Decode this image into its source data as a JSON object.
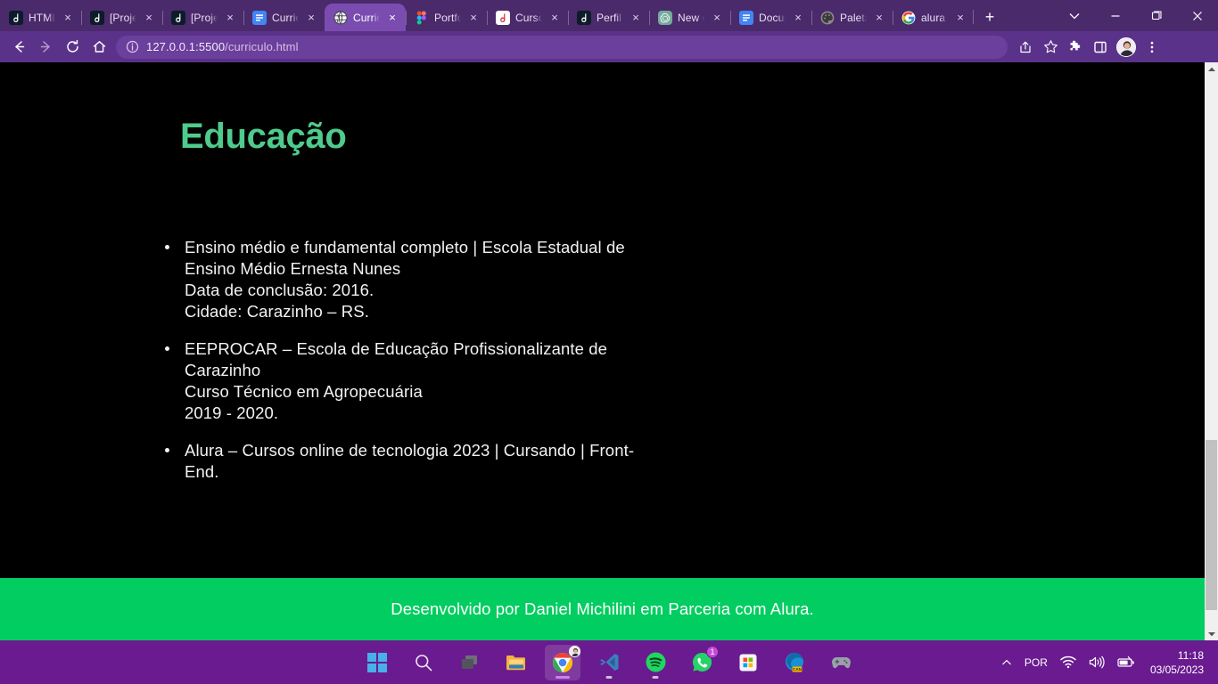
{
  "browser": {
    "tabs": [
      {
        "label": "HTML",
        "favicon": "alura-icon",
        "active": false
      },
      {
        "label": "[Projeto]",
        "favicon": "alura-icon",
        "active": false
      },
      {
        "label": "[Projeto]",
        "favicon": "alura-icon",
        "active": false
      },
      {
        "label": "Curriculo",
        "favicon": "google-docs-icon",
        "active": false
      },
      {
        "label": "Curriculo",
        "favicon": "globe-icon",
        "active": true
      },
      {
        "label": "Portfolio",
        "favicon": "figma-icon",
        "active": false
      },
      {
        "label": "Cursos",
        "favicon": "alura-light-icon",
        "active": false
      },
      {
        "label": "Perfil",
        "favicon": "alura-icon",
        "active": false
      },
      {
        "label": "New chat",
        "favicon": "chatgpt-icon",
        "active": false
      },
      {
        "label": "Documento",
        "favicon": "google-docs-icon",
        "active": false
      },
      {
        "label": "Paleta",
        "favicon": "palette-icon",
        "active": false
      },
      {
        "label": "alura",
        "favicon": "google-icon",
        "active": false
      }
    ],
    "tab_close_label": "×",
    "new_tab_label": "+",
    "tab_search_label": "∨",
    "window_controls": {
      "minimize": "—",
      "maximize": "❐",
      "close": "×"
    },
    "toolbar": {
      "back_label": "←",
      "forward_label": "→",
      "reload_label": "⟳",
      "home_label": "⌂",
      "url_host": "127.0.0.1:5500",
      "url_path": "/curriculo.html",
      "info_label": "ⓘ",
      "share_label": "share-icon",
      "bookmark_label": "☆",
      "extensions_label": "puzzle-icon",
      "sidepanel_label": "▢",
      "profile_label": "avatar",
      "menu_label": "⋮"
    },
    "scrollbar": {
      "up_label": "▲",
      "down_label": "▼"
    }
  },
  "page": {
    "title": "Educação",
    "title_color": "#4ecb8d",
    "background_color": "#000000",
    "education_items": [
      "Ensino médio e fundamental completo | Escola Estadual de Ensino Médio Ernesta Nunes\nData de conclusão: 2016.\nCidade: Carazinho – RS.",
      "EEPROCAR – Escola de Educação Profissionalizante de Carazinho\nCurso Técnico em Agropecuária\n2019 - 2020.",
      "Alura – Cursos online de tecnologia 2023 | Cursando | Front-End."
    ],
    "footer_text": "Desenvolvido por Daniel Michilini em Parceria com Alura.",
    "footer_color": "#02cd60"
  },
  "taskbar": {
    "background_color": "#6a1b8f",
    "items": [
      {
        "name": "start-button",
        "icon": "windows-icon"
      },
      {
        "name": "search-button",
        "icon": "search-icon"
      },
      {
        "name": "task-view-button",
        "icon": "task-view-icon"
      },
      {
        "name": "file-explorer-button",
        "icon": "folder-icon"
      },
      {
        "name": "chrome-button",
        "icon": "chrome-icon"
      },
      {
        "name": "vscode-button",
        "icon": "vscode-icon"
      },
      {
        "name": "spotify-button",
        "icon": "spotify-icon"
      },
      {
        "name": "whatsapp-button",
        "icon": "whatsapp-icon",
        "badge": "1"
      },
      {
        "name": "microsoft-store-button",
        "icon": "store-icon"
      },
      {
        "name": "edge-canary-button",
        "icon": "edge-canary-icon"
      },
      {
        "name": "xbox-button",
        "icon": "gamepad-icon"
      }
    ],
    "tray": {
      "overflow_label": "∧",
      "language_label": "POR",
      "wifi_label": "wifi-icon",
      "volume_label": "volume-icon",
      "battery_label": "battery-icon",
      "time": "11:18",
      "date": "03/05/2023"
    }
  }
}
